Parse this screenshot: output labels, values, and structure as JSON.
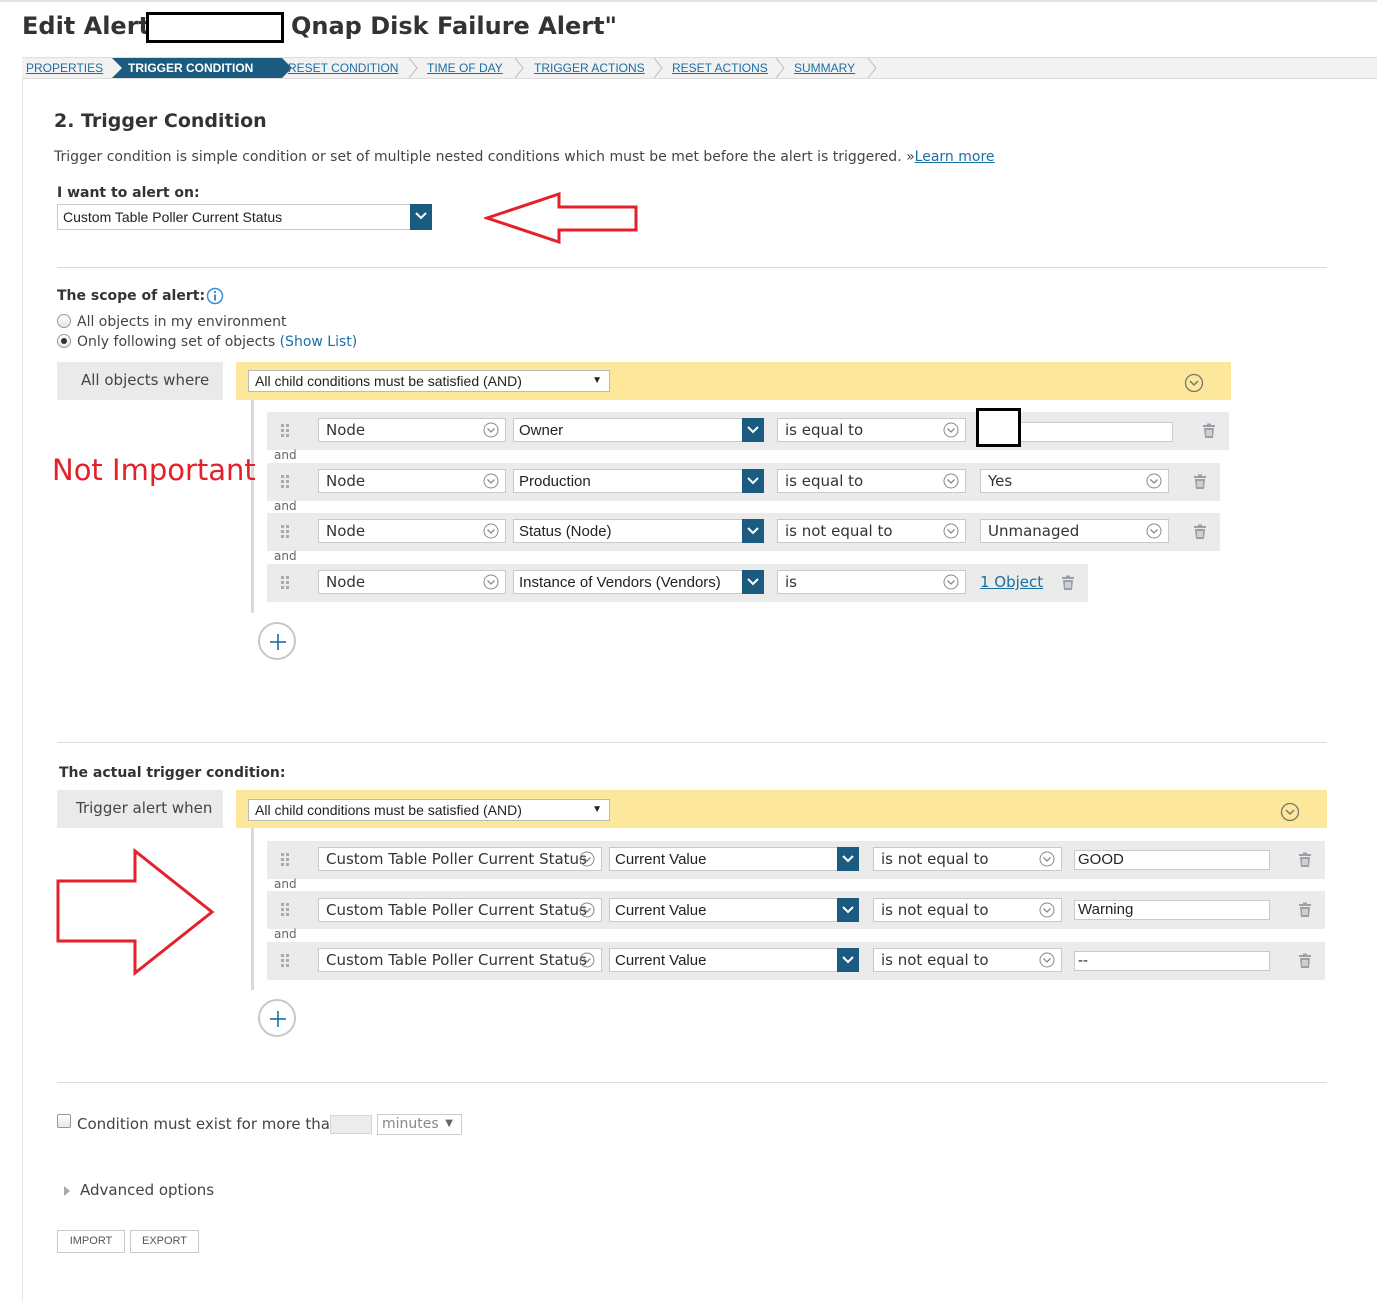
{
  "header": {
    "title_prefix": "Edit Alert -",
    "title_suffix": "Qnap Disk Failure Alert\""
  },
  "breadcrumb": [
    {
      "label": "PROPERTIES"
    },
    {
      "label": "TRIGGER CONDITION",
      "active": true
    },
    {
      "label": "RESET CONDITION"
    },
    {
      "label": "TIME OF DAY"
    },
    {
      "label": "TRIGGER ACTIONS"
    },
    {
      "label": "RESET ACTIONS"
    },
    {
      "label": "SUMMARY"
    }
  ],
  "section": {
    "title": "2. Trigger Condition",
    "description": "Trigger condition is simple condition or set of multiple nested conditions which must be met before the alert is triggered. »",
    "learn_more": "Learn more"
  },
  "alert_on": {
    "label": "I want to alert on:",
    "value": "Custom Table Poller Current Status"
  },
  "scope": {
    "label": "The scope of alert:",
    "option_all": "All objects in my environment",
    "option_following": "Only following set of objects",
    "show_list": "(Show List)",
    "selected": "option_following",
    "group_label": "All objects where",
    "group_operator": "All child conditions must be satisfied (AND)",
    "conditions": [
      {
        "object": "Node",
        "field": "Owner",
        "operator": "is equal to",
        "value": ""
      },
      {
        "object": "Node",
        "field": "Production",
        "operator": "is equal to",
        "value": "Yes"
      },
      {
        "object": "Node",
        "field": "Status (Node)",
        "operator": "is not equal to",
        "value": "Unmanaged"
      },
      {
        "object": "Node",
        "field": "Instance of Vendors (Vendors)",
        "operator": "is",
        "value": "1 Object"
      }
    ],
    "and_label": "and"
  },
  "annotation": {
    "not_important": "Not Important",
    "accent": "#e3212a"
  },
  "trigger": {
    "label": "The actual trigger condition:",
    "group_label": "Trigger alert when",
    "group_operator": "All child conditions must be satisfied (AND)",
    "conditions": [
      {
        "object": "Custom Table Poller Current Status",
        "field": "Current Value",
        "operator": "is not equal to",
        "value": "GOOD"
      },
      {
        "object": "Custom Table Poller Current Status",
        "field": "Current Value",
        "operator": "is not equal to",
        "value": "Warning"
      },
      {
        "object": "Custom Table Poller Current Status",
        "field": "Current Value",
        "operator": "is not equal to",
        "value": "--"
      }
    ]
  },
  "condition_exist": {
    "label": "Condition must exist for more than",
    "value": "",
    "unit": "minutes"
  },
  "advanced": {
    "label": "Advanced options"
  },
  "buttons": {
    "import": "IMPORT",
    "export": "EXPORT"
  },
  "colors": {
    "link": "#1a6fa3",
    "active_tab": "#1c5b80",
    "group_bar": "#fde79a",
    "red_annotation": "#e3212a"
  }
}
